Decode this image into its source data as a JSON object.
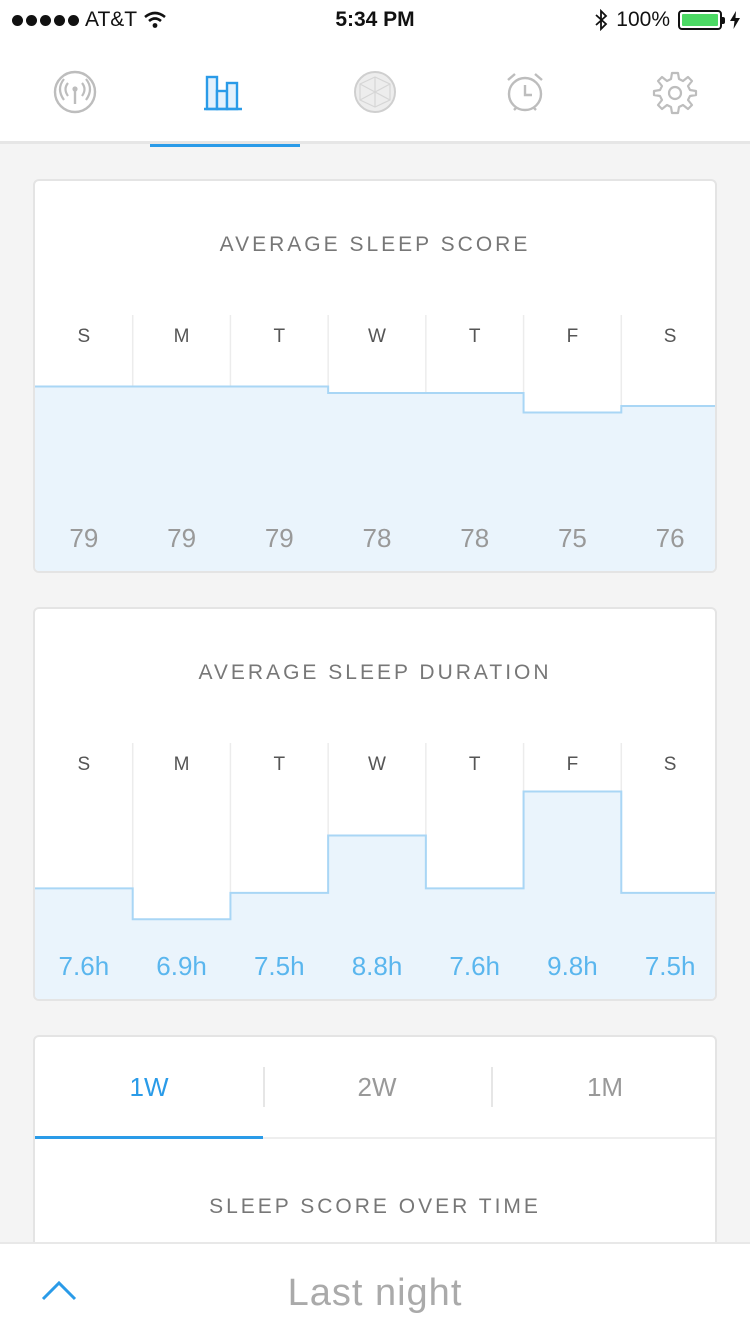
{
  "status_bar": {
    "carrier": "AT&T",
    "time": "5:34 PM",
    "battery": "100%"
  },
  "nav": {
    "active_index": 1,
    "icons": [
      "antenna-icon",
      "bar-chart-icon",
      "sphere-icon",
      "alarm-clock-icon",
      "gear-icon"
    ]
  },
  "colors": {
    "accent": "#2a9be8",
    "fill": "#eaf4fc",
    "stroke": "#a9d6f5",
    "muted": "#999999"
  },
  "score_card": {
    "title": "AVERAGE SLEEP SCORE",
    "days": [
      "S",
      "M",
      "T",
      "W",
      "T",
      "F",
      "S"
    ],
    "labels": [
      "79",
      "79",
      "79",
      "78",
      "78",
      "75",
      "76"
    ]
  },
  "duration_card": {
    "title": "AVERAGE SLEEP DURATION",
    "days": [
      "S",
      "M",
      "T",
      "W",
      "T",
      "F",
      "S"
    ],
    "labels": [
      "7.6h",
      "6.9h",
      "7.5h",
      "8.8h",
      "7.6h",
      "9.8h",
      "7.5h"
    ]
  },
  "chart_data": [
    {
      "type": "bar",
      "title": "AVERAGE SLEEP SCORE",
      "categories": [
        "S",
        "M",
        "T",
        "W",
        "T",
        "F",
        "S"
      ],
      "values": [
        79,
        79,
        79,
        78,
        78,
        75,
        76
      ],
      "ylim": [
        50,
        90
      ]
    },
    {
      "type": "bar",
      "title": "AVERAGE SLEEP DURATION",
      "categories": [
        "S",
        "M",
        "T",
        "W",
        "T",
        "F",
        "S"
      ],
      "values": [
        7.6,
        6.9,
        7.5,
        8.8,
        7.6,
        9.8,
        7.5
      ],
      "ylim": [
        5.0,
        10.9
      ]
    }
  ],
  "range": {
    "tabs": [
      "1W",
      "2W",
      "1M"
    ],
    "active_index": 0,
    "section_title": "SLEEP SCORE OVER TIME"
  },
  "bottom": {
    "title": "Last night"
  }
}
